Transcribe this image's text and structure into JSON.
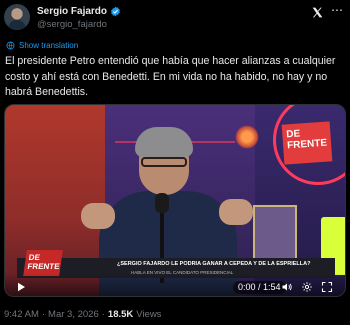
{
  "author": {
    "name": "Sergio Fajardo",
    "handle": "@sergio_fajardo"
  },
  "translation": {
    "label": "Show translation"
  },
  "tweet": {
    "text": "El presidente Petro entendió que había que hacer alianzas a cualquier costo y ahí está con Benedetti. En mi vida no ha habido, no hay y no habrá Benedettis."
  },
  "video": {
    "brand_top": "DE FRENTE",
    "brand_chyron": "DE FRENTE",
    "chyron_headline": "¿SERGIO FAJARDO LE PODRÍA GANAR A CEPEDA Y DE LA ESPRIELLA?",
    "chyron_sub": "HABLA EN VIVO EL CANDIDATO PRESIDENCIAL",
    "time_display": "0:00 / 1:54",
    "progress_fraction": 0
  },
  "meta": {
    "time": "9:42 AM",
    "separator1": "·",
    "date": "Mar 3, 2026",
    "separator2": "·",
    "views_count": "18.5K",
    "views_label": "Views"
  },
  "icons": {
    "verified": "verified-badge-icon",
    "x_logo": "x-logo-icon",
    "more": "more-icon",
    "globe": "globe-icon",
    "play": "play-icon",
    "volume": "volume-icon",
    "settings": "settings-icon",
    "fullscreen": "fullscreen-icon"
  },
  "colors": {
    "accent": "#1d9bf0",
    "background": "#000000",
    "text": "#e7e9ea",
    "muted": "#71767b"
  }
}
